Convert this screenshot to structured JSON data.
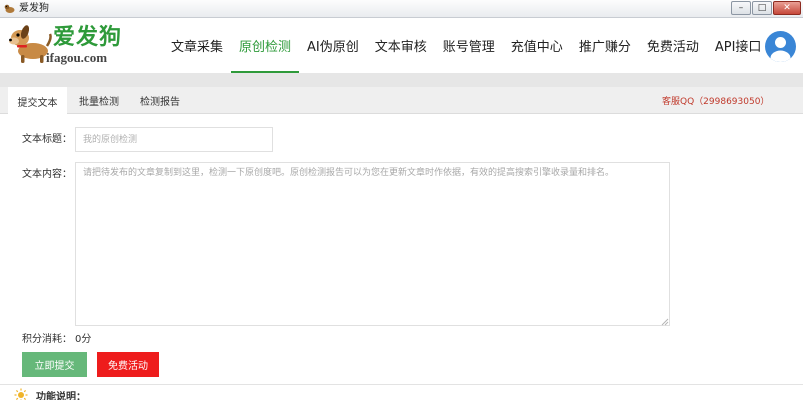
{
  "window": {
    "title": "爱发狗",
    "controls": {
      "minimize": "–",
      "maximize": "□",
      "close": "✕"
    }
  },
  "logo": {
    "brand": "爱发狗",
    "domain": "ifagou.com"
  },
  "nav": {
    "items": [
      "文章采集",
      "原创检测",
      "AI伪原创",
      "文本审核",
      "账号管理",
      "充值中心",
      "推广赚分",
      "免费活动",
      "API接口"
    ],
    "active": "原创检测"
  },
  "tabs": {
    "items": [
      "提交文本",
      "批量检测",
      "检测报告"
    ],
    "active": "提交文本"
  },
  "service": {
    "text": "客服QQ（2998693050）"
  },
  "form": {
    "title_label": "文本标题：",
    "title_placeholder": "我的原创检测",
    "content_label": "文本内容：",
    "content_placeholder": "请把待发布的文章复制到这里，检测一下原创度吧。原创检测报告可以为您在更新文章时作依据，有效的提高搜索引擎收录量和排名。",
    "cost_label": "积分消耗：",
    "cost_value": "0分",
    "submit_button": "立即提交",
    "free_button": "免费活动"
  },
  "footer": {
    "section_title": "功能说明："
  },
  "colors": {
    "accent": "#2e9a3a",
    "submit": "#66b87a",
    "danger": "#ee1c1c",
    "service": "#c0392b",
    "avatar": "#3a86d6"
  },
  "icons": {
    "app": "dog-icon",
    "avatar": "user-avatar-icon",
    "section": "sun-icon"
  }
}
